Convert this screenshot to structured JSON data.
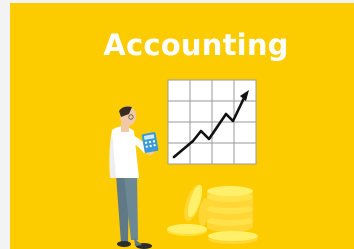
{
  "banner": {
    "title": "Accounting"
  },
  "colors": {
    "background": "#fccc00",
    "title": "#ffffff",
    "chart_line": "#111111",
    "coins": "#ffdf3a"
  },
  "icons": {
    "person": "businessman-with-calculator-icon",
    "chart": "upward-trend-chart-icon",
    "coins": "gold-coin-stack-icon"
  }
}
